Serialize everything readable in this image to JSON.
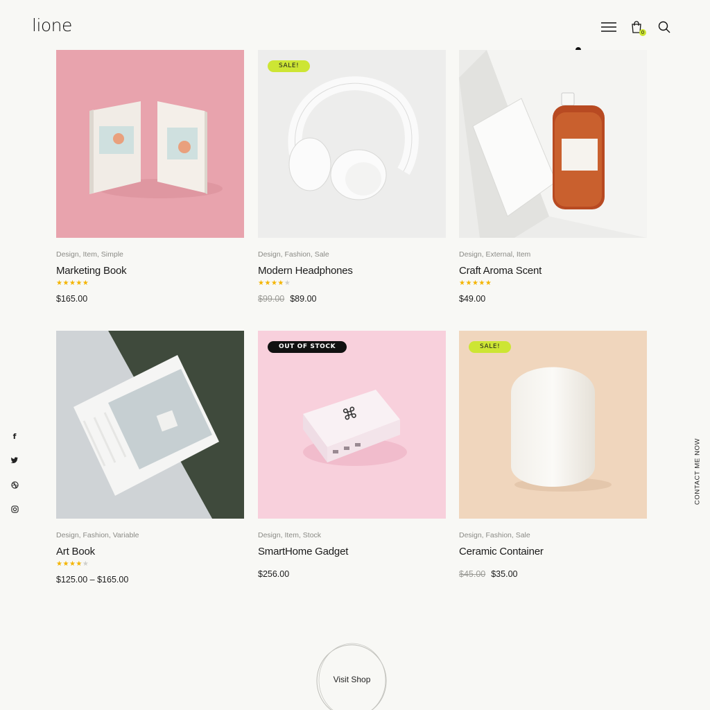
{
  "header": {
    "logo": "lione",
    "cart_count": "0",
    "icons": [
      "menu-icon",
      "bag-icon",
      "search-icon"
    ]
  },
  "products": [
    {
      "categories": "Design, Item, Simple",
      "title": "Marketing Book",
      "rating": 5,
      "price_old": "",
      "price": "$165.00",
      "badge": "",
      "image_bg": "#e8a3ad"
    },
    {
      "categories": "Design, Fashion, Sale",
      "title": "Modern Headphones",
      "rating": 4,
      "price_old": "$99.00",
      "price": "$89.00",
      "badge": "Sale!",
      "image_bg": "#ededec"
    },
    {
      "categories": "Design, External, Item",
      "title": "Craft Aroma Scent",
      "rating": 5,
      "price_old": "",
      "price": "$49.00",
      "badge": "",
      "image_bg": "#ececea"
    },
    {
      "categories": "Design, Fashion, Variable",
      "title": "Art Book",
      "rating": 4,
      "price_old": "",
      "price": "$125.00 – $165.00",
      "badge": "",
      "image_bg": "#c7ccd0"
    },
    {
      "categories": "Design, Item, Stock",
      "title": "SmartHome Gadget",
      "rating": 0,
      "price_old": "",
      "price": "$256.00",
      "badge": "Out of stock",
      "image_bg": "#f8d0dc"
    },
    {
      "categories": "Design, Fashion, Sale",
      "title": "Ceramic Container",
      "rating": 0,
      "price_old": "$45.00",
      "price": "$35.00",
      "badge": "Sale!",
      "image_bg": "#f0d6bd"
    }
  ],
  "social": [
    "facebook-icon",
    "twitter-icon",
    "dribbble-icon",
    "instagram-icon"
  ],
  "contact_label": "CONTACT ME NOW",
  "visit_shop_label": "Visit Shop",
  "colors": {
    "background": "#f8f8f5",
    "sale_badge": "#cde534",
    "oos_badge": "#111111",
    "star": "#f4b400"
  }
}
